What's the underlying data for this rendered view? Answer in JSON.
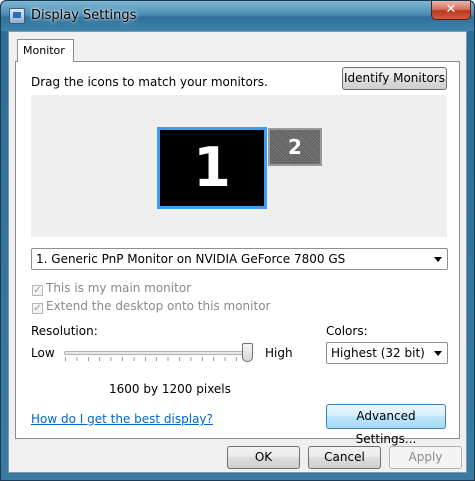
{
  "window": {
    "title": "Display Settings",
    "close_glyph": "✕"
  },
  "tabs": [
    {
      "label": "Monitor"
    }
  ],
  "monitor_panel": {
    "instruction": "Drag the icons to match your monitors.",
    "identify_label": "Identify Monitors",
    "monitors": [
      {
        "number": "1",
        "selected": true
      },
      {
        "number": "2",
        "selected": false
      }
    ],
    "monitor_select_value": "1. Generic PnP Monitor on NVIDIA GeForce 7800 GS",
    "main_monitor_label": "This is my main monitor",
    "extend_label": "Extend the desktop onto this monitor",
    "check_glyph": "✓"
  },
  "resolution": {
    "label": "Resolution:",
    "low": "Low",
    "high": "High",
    "value_text": "1600 by 1200 pixels",
    "slider_fraction": 1.0
  },
  "colors": {
    "label": "Colors:",
    "value": "Highest (32 bit)"
  },
  "help_link": "How do I get the best display?",
  "advanced_label": "Advanced Settings...",
  "footer": {
    "ok": "OK",
    "cancel": "Cancel",
    "apply": "Apply"
  },
  "icons": [
    "display-settings-icon",
    "close-icon",
    "dropdown-arrow-icon",
    "checkbox-icon"
  ],
  "accent_colors": {
    "selection_border": "#3f9cf3",
    "link": "#0066cc"
  }
}
